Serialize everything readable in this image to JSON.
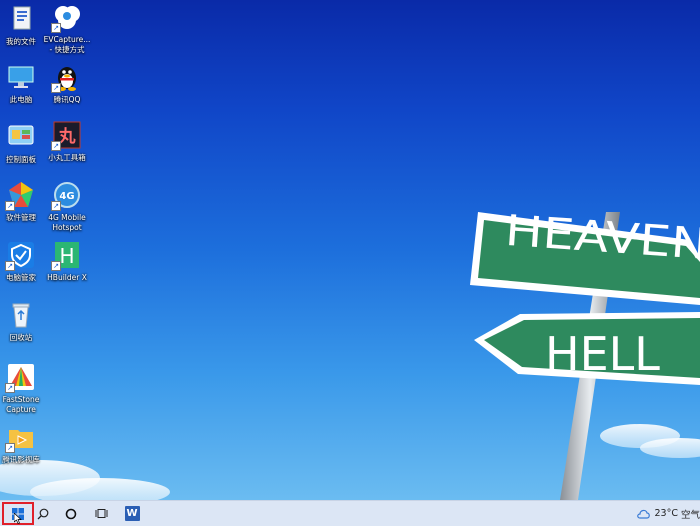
{
  "desktop": {
    "wallpaper": {
      "sign_top": "HEAVEN",
      "sign_bottom": "HELL",
      "colors": {
        "sky_top": "#0a2aa8",
        "sky_bottom": "#6bbcf1",
        "sign_green": "#2e8a5e"
      }
    },
    "icons": [
      {
        "name": "desktop-icon-my-documents",
        "label": "我的文件",
        "icon": "folder-document-icon",
        "shortcut": false
      },
      {
        "name": "desktop-icon-evcapture",
        "label": "EVCapture...\n- 快捷方式",
        "icon": "evcapture-icon",
        "shortcut": true
      },
      {
        "name": "desktop-icon-this-pc",
        "label": "此电脑",
        "icon": "computer-icon",
        "shortcut": false
      },
      {
        "name": "desktop-icon-tencent-qq",
        "label": "腾讯QQ",
        "icon": "qq-penguin-icon",
        "shortcut": true
      },
      {
        "name": "desktop-icon-control-panel",
        "label": "控制面板",
        "icon": "control-panel-icon",
        "shortcut": false
      },
      {
        "name": "desktop-icon-xiaowan-toolbox",
        "label": "小丸工具箱",
        "icon": "xiaowan-icon",
        "shortcut": true
      },
      {
        "name": "desktop-icon-software-manager",
        "label": "软件管理",
        "icon": "software-manager-icon",
        "shortcut": true
      },
      {
        "name": "desktop-icon-4g-hotspot",
        "label": "4G Mobile\nHotspot",
        "icon": "4g-hotspot-icon",
        "shortcut": true
      },
      {
        "name": "desktop-icon-pc-manager",
        "label": "电脑管家",
        "icon": "shield-icon",
        "shortcut": true
      },
      {
        "name": "desktop-icon-hbuilderx",
        "label": "HBuilder X",
        "icon": "hbuilder-icon",
        "shortcut": true
      },
      {
        "name": "desktop-icon-recycle-bin",
        "label": "回收站",
        "icon": "recycle-bin-icon",
        "shortcut": false
      },
      {
        "name": "desktop-icon-faststone",
        "label": "FastStone\nCapture",
        "icon": "faststone-icon",
        "shortcut": true
      },
      {
        "name": "desktop-icon-tencent-video",
        "label": "腾讯影视库",
        "icon": "video-folder-icon",
        "shortcut": true
      }
    ]
  },
  "taskbar": {
    "start_icon": "windows-logo-icon",
    "search_icon": "search-icon",
    "cortana_icon": "cortana-circle-icon",
    "task_view_icon": "task-view-icon",
    "pinned_app_icon": "word-icon",
    "pinned_app_letter": "W",
    "weather_temp": "23°C",
    "weather_text": "空气"
  }
}
